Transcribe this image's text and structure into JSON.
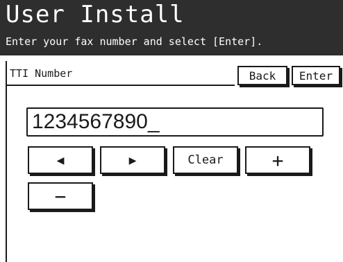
{
  "header": {
    "title": "User Install",
    "subtitle": "Enter your fax number and select [Enter]."
  },
  "field": {
    "label": "TTI Number",
    "value": "1234567890_"
  },
  "buttons": {
    "back": "Back",
    "enter": "Enter"
  },
  "keys": {
    "left": "◀",
    "right": "▶",
    "clear": "Clear",
    "plus": "+",
    "minus": "−"
  }
}
